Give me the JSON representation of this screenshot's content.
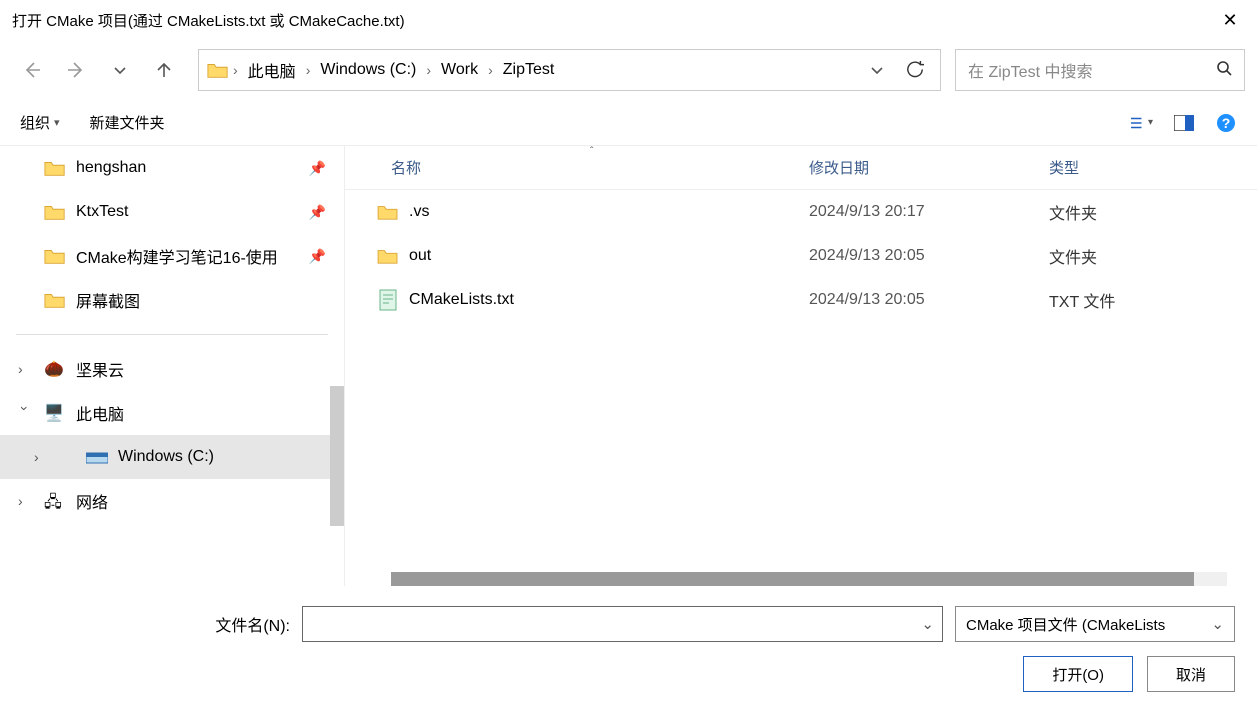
{
  "title": "打开 CMake 项目(通过 CMakeLists.txt 或 CMakeCache.txt)",
  "breadcrumb": [
    "此电脑",
    "Windows (C:)",
    "Work",
    "ZipTest"
  ],
  "search_placeholder": "在 ZipTest 中搜索",
  "toolbar": {
    "organize": "组织",
    "newfolder": "新建文件夹"
  },
  "tree": {
    "quick": [
      {
        "label": "hengshan",
        "pinned": true
      },
      {
        "label": "KtxTest",
        "pinned": true
      },
      {
        "label": "CMake构建学习笔记16-使用",
        "pinned": true
      },
      {
        "label": "屏幕截图",
        "pinned": false
      }
    ],
    "nut": "坚果云",
    "thispc": "此电脑",
    "drive": "Windows (C:)",
    "network": "网络"
  },
  "columns": {
    "name": "名称",
    "date": "修改日期",
    "type": "类型"
  },
  "files": [
    {
      "icon": "folder",
      "name": ".vs",
      "date": "2024/9/13 20:17",
      "type": "文件夹"
    },
    {
      "icon": "folder",
      "name": "out",
      "date": "2024/9/13 20:05",
      "type": "文件夹"
    },
    {
      "icon": "txt",
      "name": "CMakeLists.txt",
      "date": "2024/9/13 20:05",
      "type": "TXT 文件"
    }
  ],
  "footer": {
    "filename_label": "文件名(N):",
    "filetype": "CMake 项目文件  (CMakeLists",
    "open": "打开(O)",
    "cancel": "取消"
  }
}
